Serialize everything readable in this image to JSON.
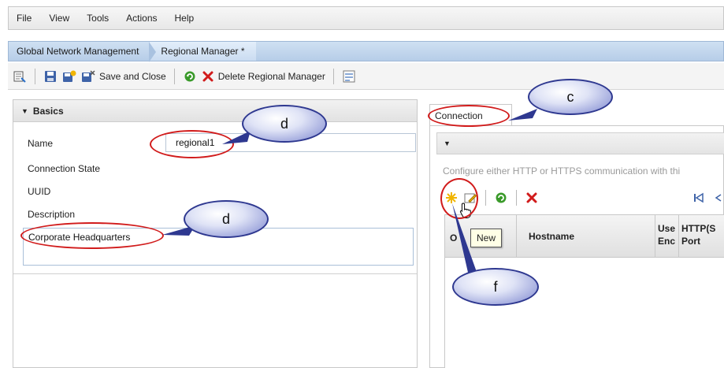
{
  "menu": [
    "File",
    "View",
    "Tools",
    "Actions",
    "Help"
  ],
  "breadcrumb": {
    "root": "Global Network Management",
    "current": "Regional Manager *"
  },
  "toolbar": {
    "save_close_label": "Save and Close",
    "delete_label": "Delete Regional Manager"
  },
  "basics": {
    "section_title": "Basics",
    "name_label": "Name",
    "name_value": "regional1",
    "connection_state_label": "Connection State",
    "uuid_label": "UUID",
    "description_label": "Description",
    "description_value": "Corporate Headquarters"
  },
  "connection": {
    "tab_label": "Connection",
    "hint_text": "Configure either HTTP or HTTPS communication with thi",
    "tooltip": "New",
    "columns": {
      "col1": "O",
      "hostname": "Hostname",
      "use_enc_1": "Use",
      "use_enc_2": "Enc",
      "http_1": "HTTP(S",
      "http_2": "Port"
    }
  },
  "callouts": {
    "c": "c",
    "d1": "d",
    "d2": "d",
    "f": "f"
  },
  "colors": {
    "tab_strip": "#b6cde8",
    "callout_border": "#2e3890",
    "highlight_oval": "#d11b1b",
    "delete_red": "#d11b1b",
    "refresh_green": "#3a9a2a",
    "new_star": "#f0b400"
  }
}
